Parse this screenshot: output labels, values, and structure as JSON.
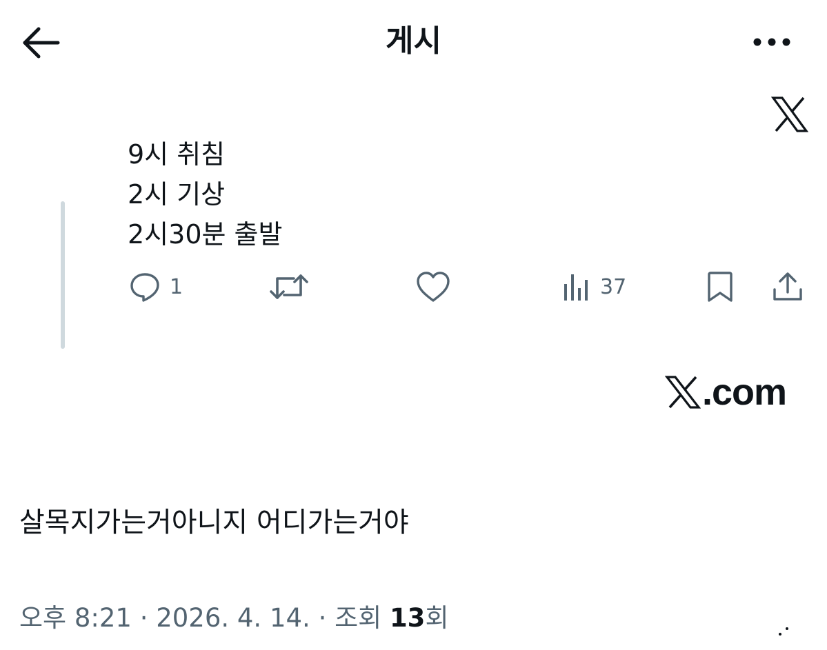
{
  "header": {
    "title": "게시",
    "back_icon": "arrow-left-icon",
    "more_icon": "more-horizontal-icon"
  },
  "quoted_post": {
    "lines": [
      "9시 취침",
      "2시 기상",
      "2시30분 출발"
    ],
    "actions": {
      "reply_count": "1",
      "views_count": "37"
    }
  },
  "watermark": {
    "domain_text": ".com"
  },
  "post": {
    "text": "살목지가는거아니지 어디가는거야",
    "timestamp": "오후 8:21 · 2026. 4. 14. · 조회 ",
    "views": "13",
    "views_suffix": "회"
  },
  "colors": {
    "text_primary": "#0f1419",
    "text_secondary": "#536471",
    "thread_line": "#cfd9de"
  }
}
